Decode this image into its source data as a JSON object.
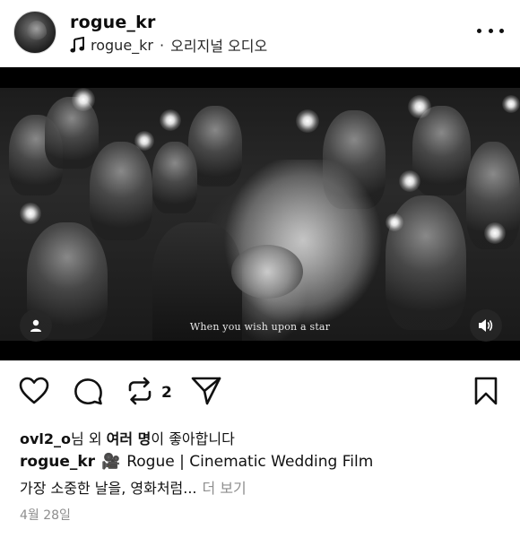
{
  "header": {
    "username": "rogue_kr",
    "audio_artist": "rogue_kr",
    "audio_sep": "·",
    "audio_label": "오리지널 오디오",
    "avatar_icon": "profile-avatar",
    "more_icon": "more-horizontal-icon"
  },
  "media": {
    "subtitle": "When you wish upon a star",
    "user_icon": "person-icon",
    "sound_icon": "speaker-icon"
  },
  "actions": {
    "like_icon": "heart-icon",
    "comment_icon": "comment-icon",
    "repost_icon": "repost-icon",
    "repost_count": "2",
    "share_icon": "send-icon",
    "save_icon": "bookmark-icon"
  },
  "likes": {
    "user": "ovl2_o",
    "mid": "님 외 ",
    "bold": "여러 명",
    "end": "이 좋아합니다"
  },
  "caption": {
    "user": "rogue_kr",
    "emoji": "🎥",
    "text": "Rogue | Cinematic Wedding Film",
    "line2": "가장 소중한 날을, 영화처럼...",
    "more": "더 보기"
  },
  "date": "4월 28일"
}
